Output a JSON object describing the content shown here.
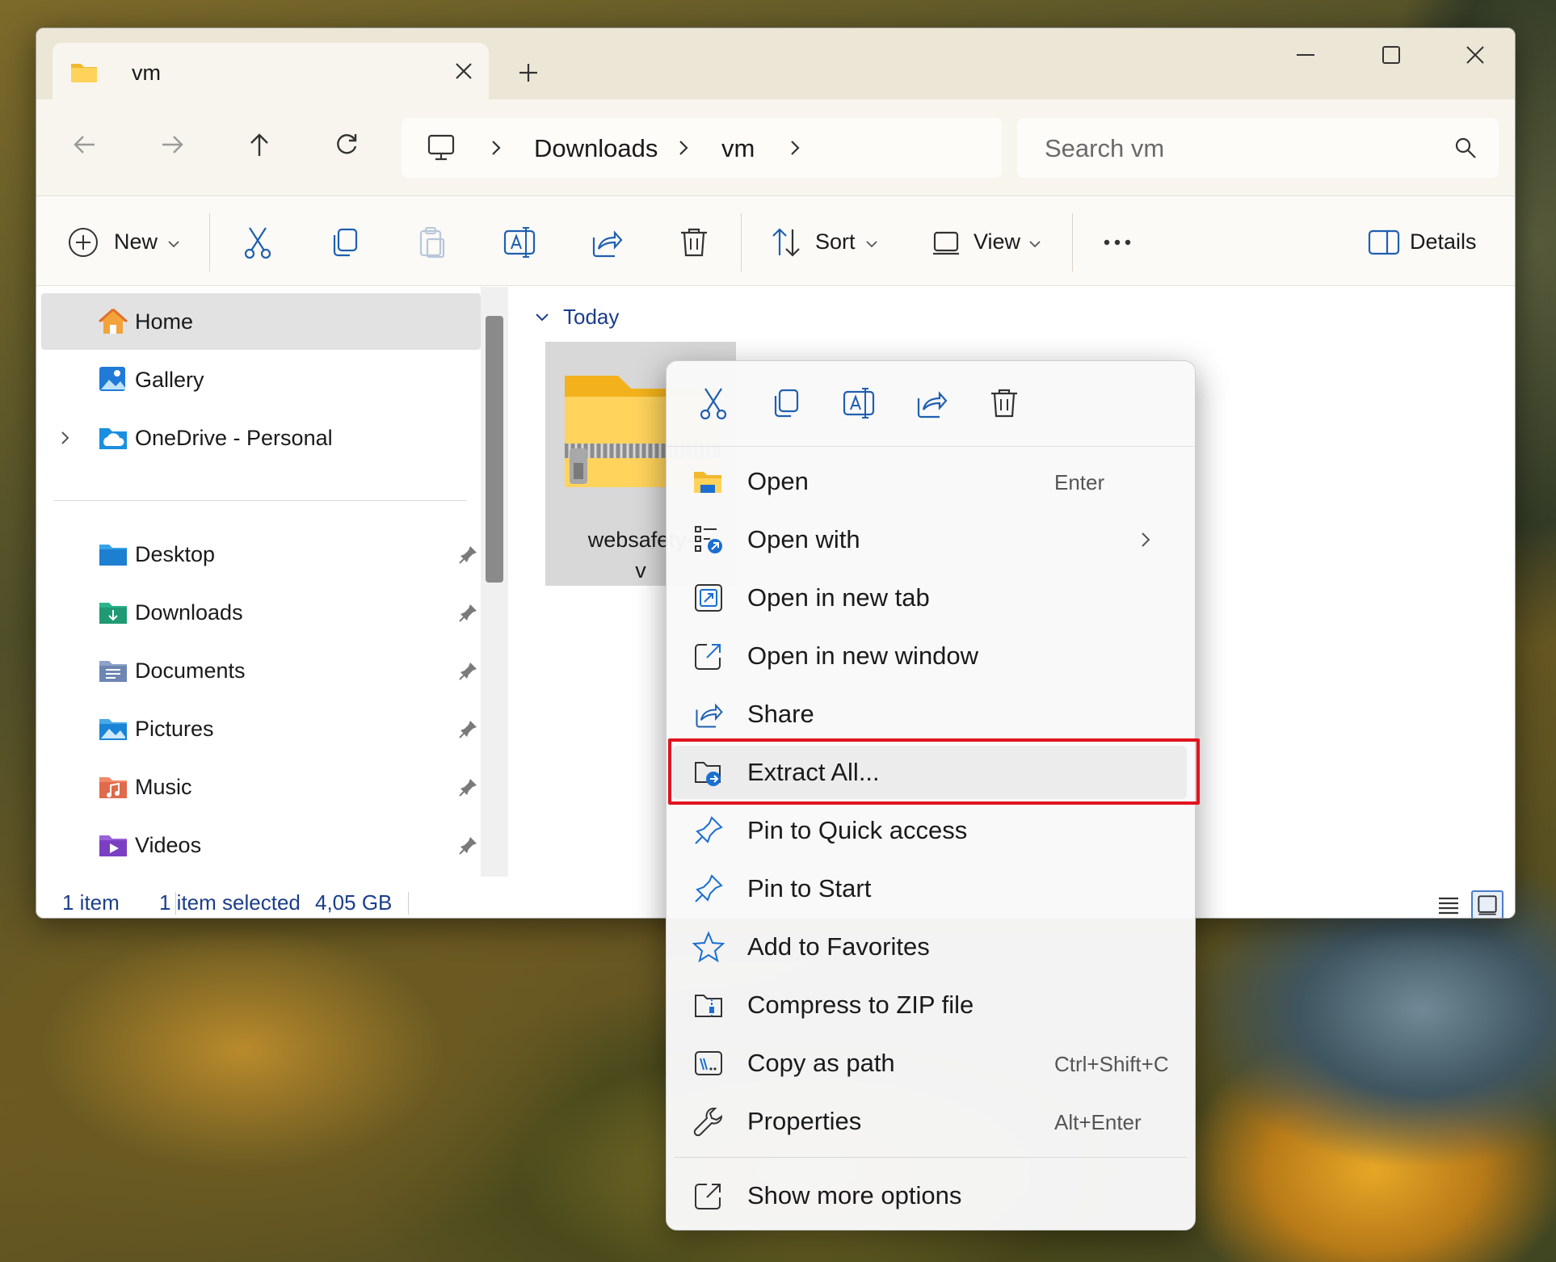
{
  "tab": {
    "title": "vm"
  },
  "address": {
    "crumbs": [
      "Downloads",
      "vm"
    ]
  },
  "search": {
    "placeholder": "Search vm"
  },
  "toolbar": {
    "new_label": "New",
    "sort_label": "Sort",
    "view_label": "View",
    "details_label": "Details"
  },
  "sidebar": {
    "items": [
      {
        "label": "Home",
        "icon": "home-icon"
      },
      {
        "label": "Gallery",
        "icon": "gallery-icon"
      },
      {
        "label": "OneDrive - Personal",
        "icon": "onedrive-icon"
      }
    ],
    "pinned": [
      {
        "label": "Desktop",
        "icon": "desktop-folder-icon"
      },
      {
        "label": "Downloads",
        "icon": "downloads-folder-icon"
      },
      {
        "label": "Documents",
        "icon": "documents-folder-icon"
      },
      {
        "label": "Pictures",
        "icon": "pictures-folder-icon"
      },
      {
        "label": "Music",
        "icon": "music-folder-icon"
      },
      {
        "label": "Videos",
        "icon": "videos-folder-icon"
      }
    ]
  },
  "group": {
    "label": "Today"
  },
  "file": {
    "name_line1": "websafety-",
    "name_line2": "v"
  },
  "status": {
    "count": "1 item",
    "selected": "1 item selected",
    "size": "4,05 GB"
  },
  "context_menu": {
    "items": [
      {
        "label": "Open",
        "shortcut": "Enter",
        "icon": "folder-open-icon"
      },
      {
        "label": "Open with",
        "shortcut": "",
        "icon": "open-with-icon",
        "submenu": true
      },
      {
        "label": "Open in new tab",
        "shortcut": "",
        "icon": "new-tab-icon"
      },
      {
        "label": "Open in new window",
        "shortcut": "",
        "icon": "new-window-icon"
      },
      {
        "label": "Share",
        "shortcut": "",
        "icon": "share-icon"
      },
      {
        "label": "Extract All...",
        "shortcut": "",
        "icon": "extract-icon",
        "highlighted": true
      },
      {
        "label": "Pin to Quick access",
        "shortcut": "",
        "icon": "pin-icon"
      },
      {
        "label": "Pin to Start",
        "shortcut": "",
        "icon": "pin-icon"
      },
      {
        "label": "Add to Favorites",
        "shortcut": "",
        "icon": "star-icon"
      },
      {
        "label": "Compress to ZIP file",
        "shortcut": "",
        "icon": "zip-icon"
      },
      {
        "label": "Copy as path",
        "shortcut": "Ctrl+Shift+C",
        "icon": "copy-path-icon"
      },
      {
        "label": "Properties",
        "shortcut": "Alt+Enter",
        "icon": "wrench-icon"
      }
    ],
    "more_options": "Show more options"
  },
  "colors": {
    "accent": "#1a6fd0",
    "highlight_border": "#e0141e",
    "titlebar": "#ece6d6"
  }
}
